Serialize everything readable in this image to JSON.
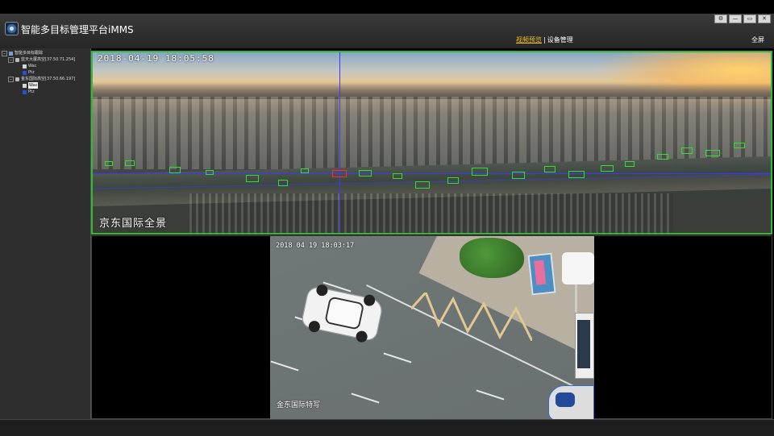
{
  "app": {
    "title": "智能多目标管理平台iMMS",
    "window_buttons": [
      "⚙",
      "—",
      "▭",
      "✕"
    ]
  },
  "nav": {
    "items": [
      "视频预览",
      "设备管理"
    ],
    "active": "视频预览",
    "fullscreen_label": "全屏"
  },
  "sidebar": {
    "root": "智能多目标跟踪",
    "devices": [
      {
        "label": "蓝天大厦高空[37.50.71.254]",
        "children": [
          "Wac",
          "Ptz"
        ]
      },
      {
        "label": "金东国际高空[37.50.66.197]",
        "children": [
          "Wac",
          "Ptz"
        ],
        "selected_child": "Wac"
      }
    ]
  },
  "panorama": {
    "timestamp": "2018-04-19 18:05:58",
    "caption": "京东国际全景"
  },
  "closeup": {
    "timestamp": "2018 04 19 18:03:17",
    "caption": "金东国际特写"
  },
  "colors": {
    "accent_active": "#f0c020",
    "tracking_box": "#2fe02f",
    "selected_box": "#ff2a2a",
    "guide_line": "#3a3aff"
  }
}
